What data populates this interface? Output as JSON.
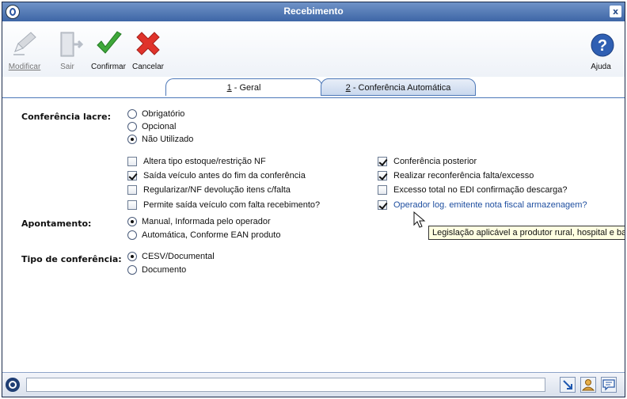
{
  "window": {
    "title": "Recebimento",
    "close_glyph": "x"
  },
  "toolbar": {
    "modificar": "Modificar",
    "sair": "Sair",
    "confirmar": "Confirmar",
    "cancelar": "Cancelar",
    "ajuda": "Ajuda"
  },
  "tabs": [
    {
      "num": "1",
      "label": " - Geral"
    },
    {
      "num": "2",
      "label": " - Conferência Automática"
    }
  ],
  "form": {
    "conferencia_lacre": {
      "label": "Conferência lacre:",
      "options": [
        "Obrigatório",
        "Opcional",
        "Não Utilizado"
      ],
      "selected": "Não Utilizado"
    },
    "checks_left": [
      {
        "label": "Altera tipo estoque/restrição NF",
        "checked": false
      },
      {
        "label": "Saída veículo antes do fim da conferência",
        "checked": true
      },
      {
        "label": "Regularizar/NF devolução itens c/falta",
        "checked": false
      },
      {
        "label": "Permite saída veículo com falta recebimento?",
        "checked": false
      }
    ],
    "checks_right": [
      {
        "label": "Conferência posterior",
        "checked": true
      },
      {
        "label": "Realizar reconferência falta/excesso",
        "checked": true
      },
      {
        "label": "Excesso total no EDI confirmação descarga?",
        "checked": false
      },
      {
        "label": "Operador log. emitente nota fiscal armazenagem?",
        "checked": true
      }
    ],
    "apontamento": {
      "label": "Apontamento:",
      "options": [
        "Manual, Informada pelo operador",
        "Automática, Conforme EAN produto"
      ],
      "selected": "Manual, Informada pelo operador"
    },
    "tipo_conferencia": {
      "label": "Tipo de conferência:",
      "options": [
        "CESV/Documental",
        "Documento"
      ],
      "selected": "CESV/Documental"
    }
  },
  "tooltip": "Legislação aplicável a produtor rural, hospital e banc",
  "colors": {
    "title_bar": "#4a72b0",
    "link_text": "#1f4fa0",
    "tooltip_bg": "#ffffe1"
  }
}
